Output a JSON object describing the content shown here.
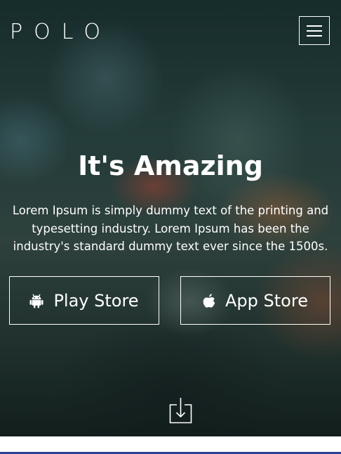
{
  "header": {
    "logo_text": "POLO",
    "menu_icon": "hamburger-menu-icon"
  },
  "hero": {
    "title": "It's Amazing",
    "description": "Lorem Ipsum is simply dummy text of the printing and typesetting industry. Lorem Ipsum has been the industry's standard dummy text ever since the 1500s.",
    "buttons": [
      {
        "label": "Play Store",
        "icon": "android-icon"
      },
      {
        "label": "App Store",
        "icon": "apple-icon"
      }
    ],
    "scroll_icon": "download-arrow-icon"
  },
  "colors": {
    "text": "#ffffff",
    "bottom_accent": "#2a3f8f"
  }
}
